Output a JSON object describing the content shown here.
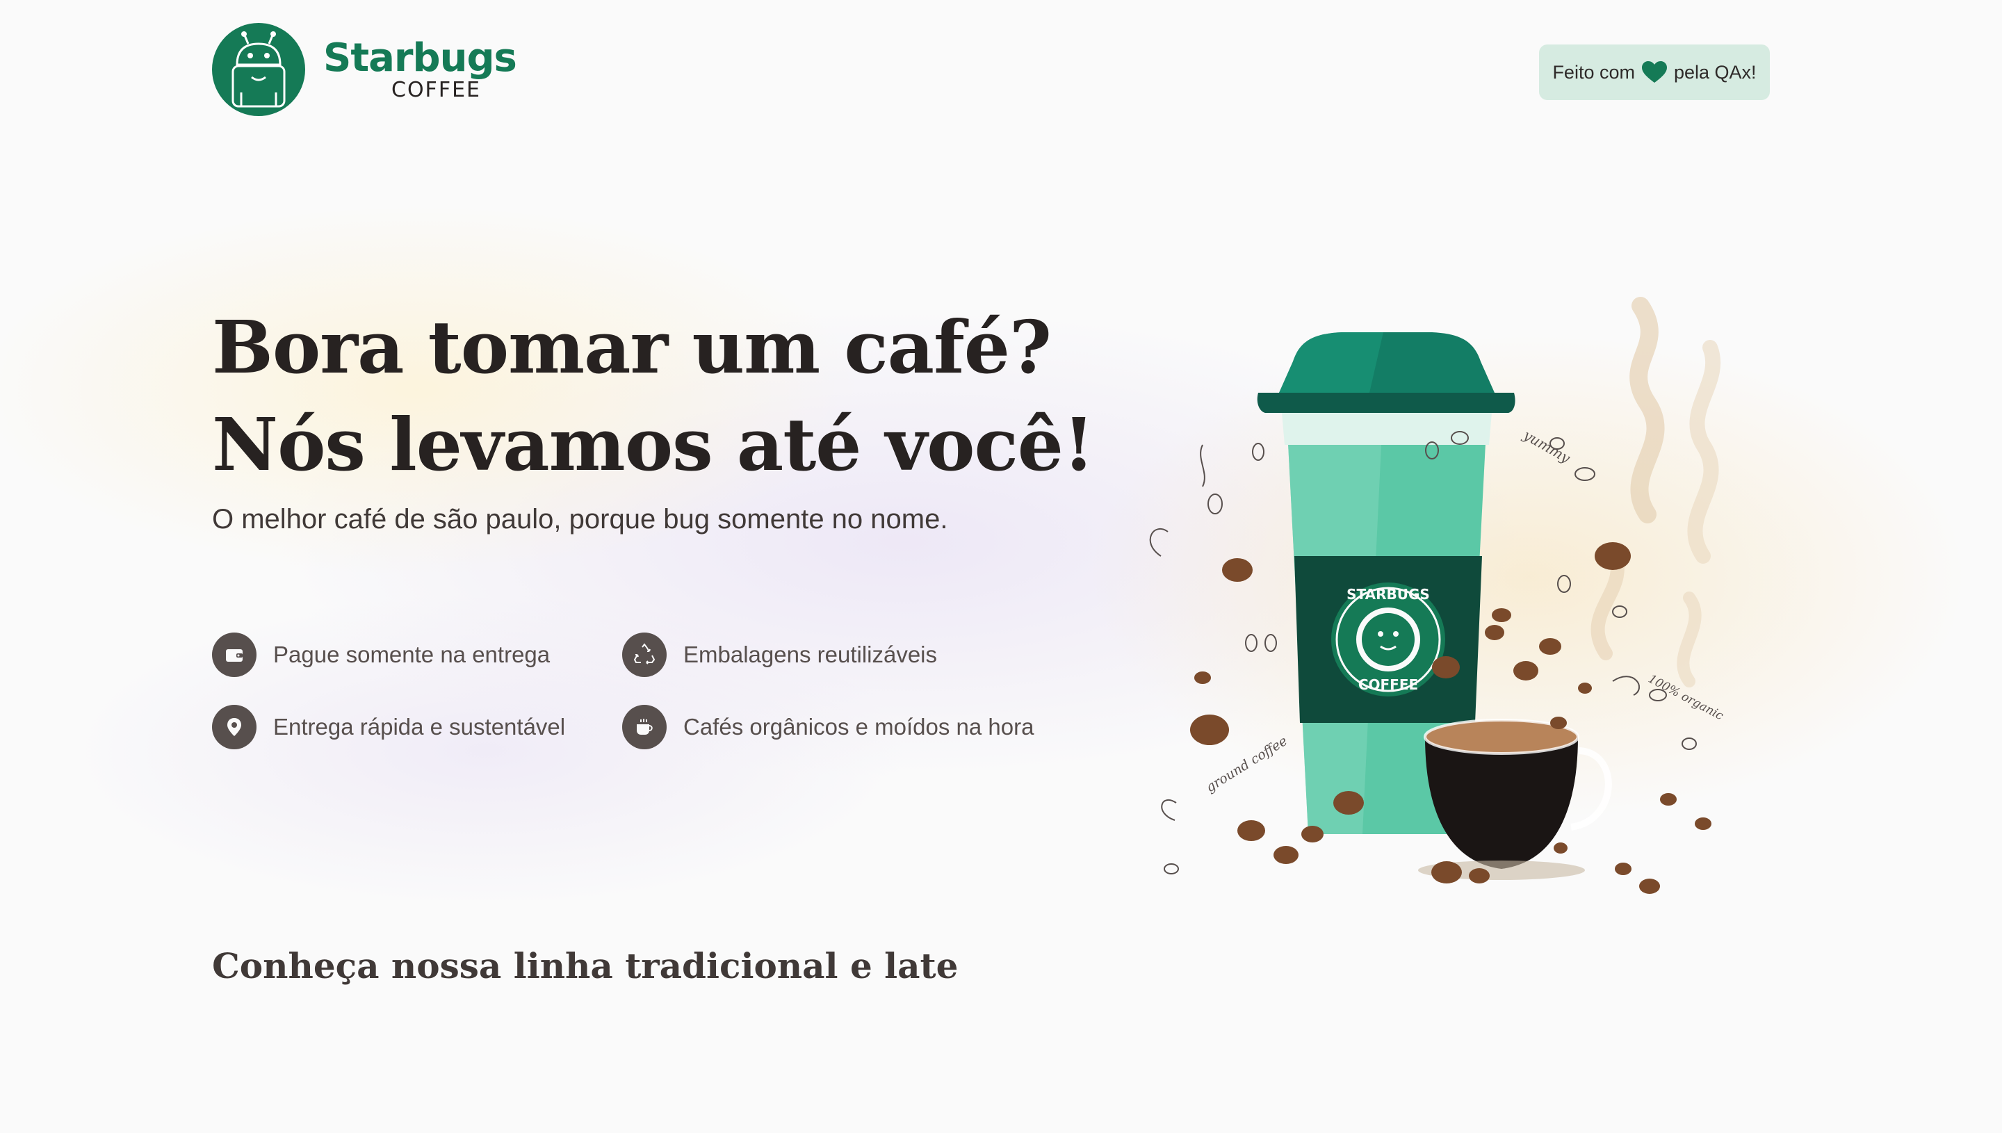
{
  "brand": {
    "name": "Starbugs",
    "sub": "COFFEE",
    "primary_color": "#157a56",
    "dark_color": "#272221"
  },
  "header": {
    "made_with_prefix": "Feito com",
    "made_with_suffix": "pela QAx!",
    "heart_icon": "heart-icon",
    "badge_bg": "#d6ebe1"
  },
  "hero": {
    "title_line1": "Bora tomar um café?",
    "title_line2": "Nós levamos até você!",
    "subtitle": "O melhor café de são paulo, porque bug somente no nome.",
    "features": [
      {
        "icon": "wallet-icon",
        "label": "Pague somente na entrega"
      },
      {
        "icon": "recycle-icon",
        "label": "Embalagens reutilizáveis"
      },
      {
        "icon": "map-pin-icon",
        "label": "Entrega rápida e sustentável"
      },
      {
        "icon": "coffee-cup-icon",
        "label": "Cafés orgânicos e moídos na hora"
      }
    ]
  },
  "illustration": {
    "cup_badge_top": "STARBUGS",
    "cup_badge_bottom": "COFFEE",
    "tag_yummy": "yummy",
    "tag_organic": "100% organic",
    "tag_ground": "ground coffee"
  },
  "products_section": {
    "title": "Conheça nossa linha tradicional e late"
  }
}
